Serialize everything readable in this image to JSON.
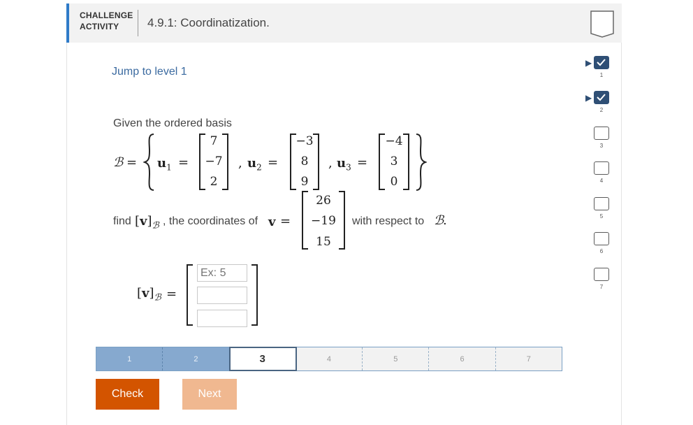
{
  "header": {
    "badge_line1": "CHALLENGE",
    "badge_line2": "ACTIVITY",
    "title": "4.9.1: Coordinatization."
  },
  "jump_link": "Jump to level 1",
  "prompt": "Given the ordered basis",
  "math": {
    "basis_symbol": "ℬ",
    "equals": "=",
    "u1_label": "u",
    "u1_sub": "1",
    "u2_label": "u",
    "u2_sub": "2",
    "u3_label": "u",
    "u3_sub": "3",
    "u1": [
      "7",
      "−7",
      "2"
    ],
    "u2": [
      "−3",
      "8",
      "9"
    ],
    "u3": [
      "−4",
      "3",
      "0"
    ],
    "v_label": "v",
    "v": [
      "26",
      "−19",
      "15"
    ]
  },
  "find": {
    "prefix": "find",
    "middle": ", the coordinates of",
    "suffix": "with respect to"
  },
  "answer": {
    "placeholders": [
      "Ex: 5",
      "",
      ""
    ]
  },
  "progress": {
    "segments": [
      "1",
      "2",
      "3",
      "4",
      "5",
      "6",
      "7"
    ],
    "current": 3,
    "completed": 2
  },
  "buttons": {
    "check": "Check",
    "next": "Next"
  },
  "levels": {
    "items": [
      {
        "num": "1",
        "state": "done",
        "current": true
      },
      {
        "num": "2",
        "state": "done",
        "current": true
      },
      {
        "num": "3",
        "state": "open"
      },
      {
        "num": "4",
        "state": "open"
      },
      {
        "num": "5",
        "state": "open"
      },
      {
        "num": "6",
        "state": "open"
      },
      {
        "num": "7",
        "state": "open"
      }
    ]
  },
  "colors": {
    "accent_blue": "#2f7bc8",
    "check_orange": "#d35400",
    "next_disabled": "#f0b890",
    "progress_done": "#86a9cf",
    "level_done": "#2f4f75"
  }
}
